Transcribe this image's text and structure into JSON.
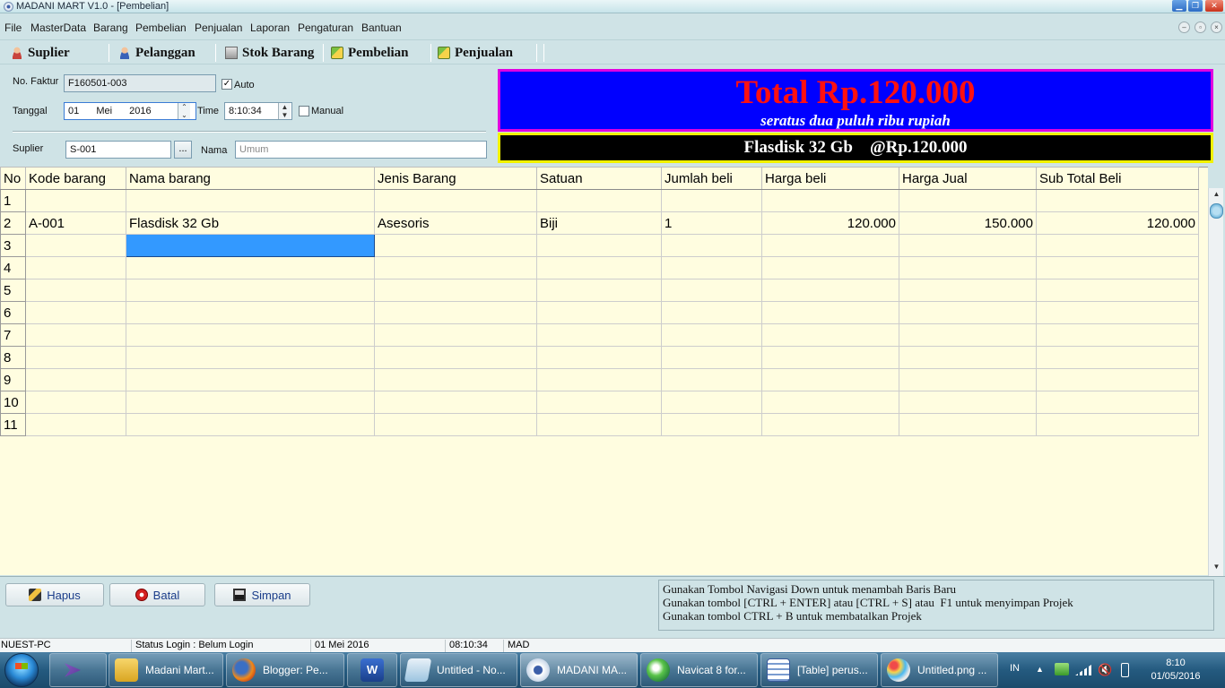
{
  "window": {
    "title": "MADANI MART V1.0 - [Pembelian]"
  },
  "menu": [
    "File",
    "MasterData",
    "Barang",
    "Pembelian",
    "Penjualan",
    "Laporan",
    "Pengaturan",
    "Bantuan"
  ],
  "toolbar": {
    "suplier": "Suplier",
    "pelanggan": "Pelanggan",
    "stok_barang": "Stok Barang",
    "pembelian": "Pembelian",
    "penjualan": "Penjualan"
  },
  "form": {
    "no_faktur_label": "No. Faktur",
    "no_faktur_value": "F160501-003",
    "auto_label": "Auto",
    "auto_checked": "✓",
    "tanggal_label": "Tanggal",
    "tanggal_day": "01",
    "tanggal_month": "Mei",
    "tanggal_year": "2016",
    "time_label": "Time",
    "time_value": "8:10:34",
    "manual_label": "Manual",
    "suplier_label": "Suplier",
    "suplier_value": "S-001",
    "dots": "...",
    "nama_label": "Nama",
    "nama_placeholder": "Umum"
  },
  "total": {
    "amount": "Total Rp.120.000",
    "words": "seratus dua puluh ribu rupiah",
    "item_line": "Flasdisk 32 Gb    @Rp.120.000"
  },
  "grid": {
    "headers": [
      "No",
      "Kode barang",
      "Nama barang",
      "Jenis Barang",
      "Satuan",
      "Jumlah beli",
      "Harga beli",
      "Harga Jual",
      "Sub Total Beli"
    ],
    "rows": [
      [
        "1",
        "",
        "",
        "",
        "",
        "",
        "",
        "",
        ""
      ],
      [
        "2",
        "A-001",
        "Flasdisk 32 Gb",
        "Asesoris",
        "Biji",
        "1",
        "120.000",
        "150.000",
        "120.000"
      ],
      [
        "3",
        "",
        "",
        "",
        "",
        "",
        "",
        "",
        ""
      ],
      [
        "4",
        "",
        "",
        "",
        "",
        "",
        "",
        "",
        ""
      ],
      [
        "5",
        "",
        "",
        "",
        "",
        "",
        "",
        "",
        ""
      ],
      [
        "6",
        "",
        "",
        "",
        "",
        "",
        "",
        "",
        ""
      ],
      [
        "7",
        "",
        "",
        "",
        "",
        "",
        "",
        "",
        ""
      ],
      [
        "8",
        "",
        "",
        "",
        "",
        "",
        "",
        "",
        ""
      ],
      [
        "9",
        "",
        "",
        "",
        "",
        "",
        "",
        "",
        ""
      ],
      [
        "10",
        "",
        "",
        "",
        "",
        "",
        "",
        "",
        ""
      ],
      [
        "11",
        "",
        "",
        "",
        "",
        "",
        "",
        "",
        ""
      ]
    ]
  },
  "buttons": {
    "hapus": "Hapus",
    "batal": "Batal",
    "simpan": "Simpan"
  },
  "help": [
    "Gunakan Tombol Navigasi Down untuk menambah Baris Baru",
    "Gunakan tombol [CTRL + ENTER] atau [CTRL + S] atau  F1 untuk menyimpan Projek",
    "Gunakan tombol CTRL + B untuk membatalkan Projek"
  ],
  "status": {
    "pc": "NUEST-PC",
    "login": "Status Login : Belum Login",
    "date": "01 Mei 2016",
    "time": "08:10:34",
    "code": "MAD"
  },
  "taskbar": {
    "tasks": [
      "Madani Mart...",
      "Blogger: Pe...",
      "",
      "Untitled - No...",
      "MADANI MA...",
      "Navicat 8 for...",
      "[Table] perus...",
      "Untitled.png ..."
    ],
    "lang": "IN",
    "clock_time": "8:10",
    "clock_date": "01/05/2016"
  },
  "colors": {
    "total_bg": "#0000ff",
    "total_border": "#e000e0",
    "total_text": "#ff1010",
    "item_bg": "#000000",
    "item_border": "#f2f200",
    "grid_bg": "#fffde0",
    "selected_cell": "#3399ff"
  }
}
